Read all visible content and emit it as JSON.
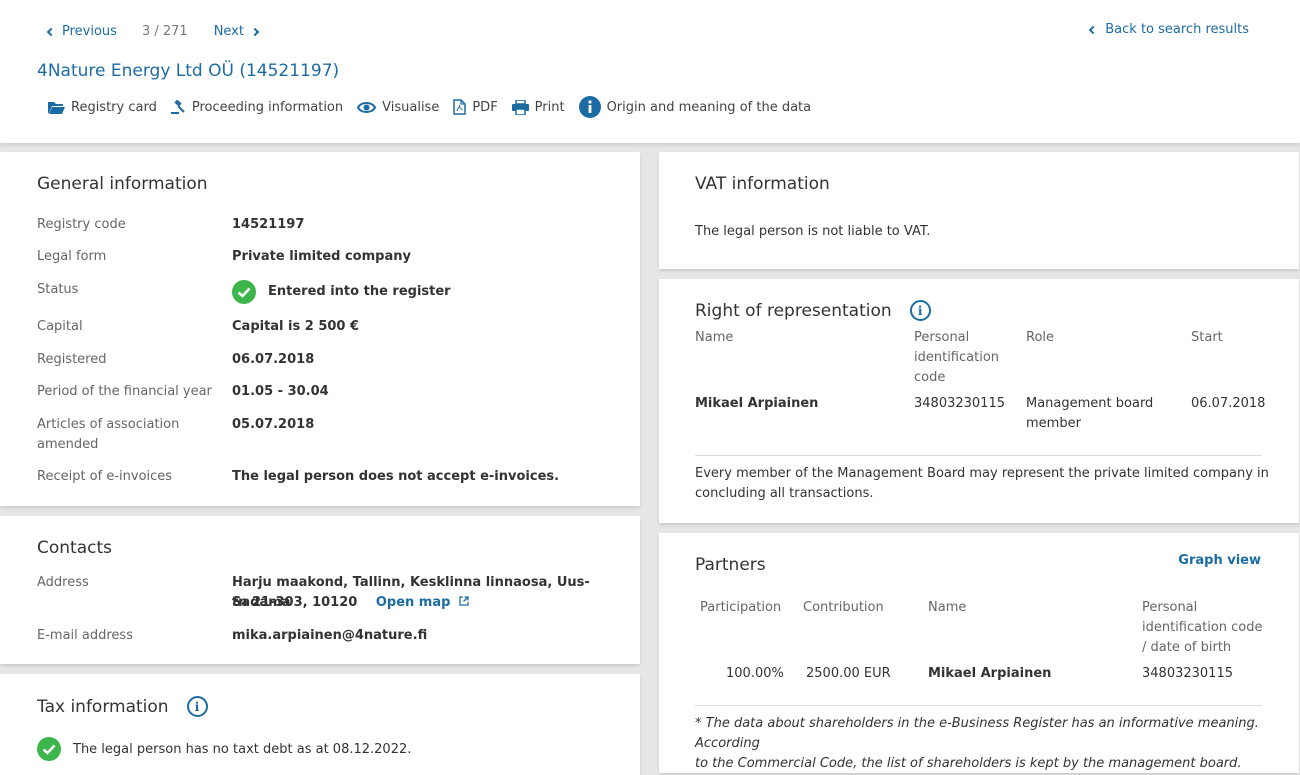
{
  "nav": {
    "previous": "Previous",
    "counter": "3 / 271",
    "next": "Next",
    "back": "Back to search results"
  },
  "company": {
    "title": "4Nature Energy Ltd OÜ (14521197)"
  },
  "actions": [
    {
      "label": "Registry card",
      "icon": "folder-icon"
    },
    {
      "label": "Proceeding information",
      "icon": "gavel-icon"
    },
    {
      "label": "Visualise",
      "icon": "eye-icon"
    },
    {
      "label": "PDF",
      "icon": "pdf-icon"
    },
    {
      "label": "Print",
      "icon": "print-icon"
    },
    {
      "label": "Origin and meaning of the data",
      "icon": "info-icon"
    }
  ],
  "general": {
    "title": "General information",
    "rows": [
      {
        "label": "Registry code",
        "value": "14521197"
      },
      {
        "label": "Legal form",
        "value": "Private limited company"
      },
      {
        "label": "Status",
        "value": "Entered into the register"
      },
      {
        "label": "Capital",
        "value": "Capital is 2 500 €"
      },
      {
        "label": "Registered",
        "value": "06.07.2018"
      },
      {
        "label": "Period of the financial year",
        "value": "01.05 - 30.04"
      },
      {
        "label": "Articles of association amended",
        "value": "05.07.2018"
      },
      {
        "label": "Receipt of e-invoices",
        "value": "The legal person does not accept e-invoices."
      }
    ]
  },
  "contacts": {
    "title": "Contacts",
    "address_label": "Address",
    "address_line1": "Harju maakond, Tallinn, Kesklinna linnaosa, Uus-Sadama",
    "address_line2": "tn 21-303, 10120",
    "open_map": "Open map",
    "email_label": "E-mail address",
    "email": "mika.arpiainen@4nature.fi"
  },
  "tax": {
    "title": "Tax information",
    "text": "The legal person has no taxt debt as at 08.12.2022."
  },
  "vat": {
    "title": "VAT information",
    "text": "The legal person is not liable to VAT."
  },
  "representation": {
    "title": "Right of representation",
    "headers": {
      "name": "Name",
      "pic1": "Personal",
      "pic2": "identification",
      "pic3": "code",
      "role": "Role",
      "start": "Start"
    },
    "row": {
      "name": "Mikael Arpiainen",
      "code": "34803230115",
      "role1": "Management board",
      "role2": "member",
      "start": "06.07.2018"
    },
    "note1": "Every member of the Management Board may represent the private limited company in",
    "note2": "concluding all transactions."
  },
  "partners": {
    "title": "Partners",
    "graph_view": "Graph view",
    "headers": {
      "participation": "Participation",
      "contribution": "Contribution",
      "name": "Name",
      "pic1": "Personal",
      "pic2": "identification code",
      "pic3": "/ date of birth"
    },
    "row": {
      "participation": "100.00%",
      "contribution": "2500.00 EUR",
      "name": "Mikael Arpiainen",
      "code": "34803230115"
    },
    "note1": "* The data about shareholders in the e-Business Register has an informative meaning. According",
    "note2": "to the Commercial Code, the list of shareholders is kept by the management board."
  },
  "colors": {
    "accent": "#1c6ca3",
    "success": "#3cb54a"
  }
}
